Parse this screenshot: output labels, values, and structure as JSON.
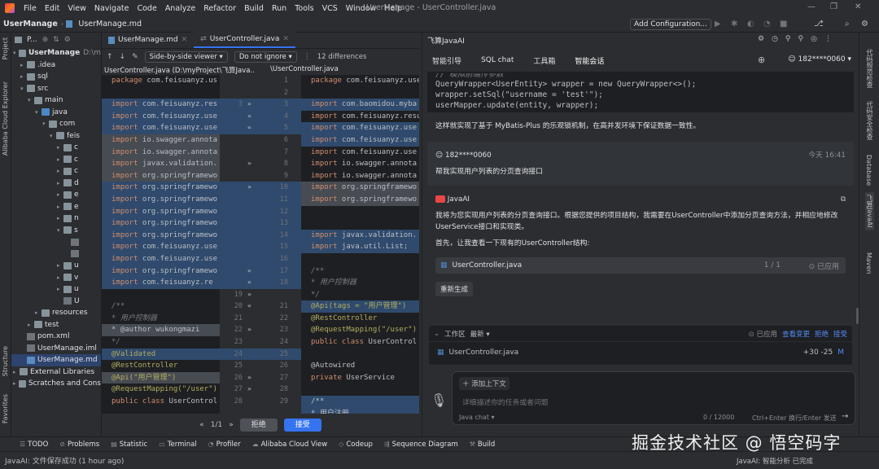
{
  "menu": [
    "File",
    "Edit",
    "View",
    "Navigate",
    "Code",
    "Analyze",
    "Refactor",
    "Build",
    "Run",
    "Tools",
    "VCS",
    "Window",
    "Help"
  ],
  "window_title": "UserManage - UserController.java",
  "breadcrumb": {
    "project": "UserManage",
    "file": "UserManage.md"
  },
  "add_config": "Add Configuration...",
  "project_panel": {
    "title": "P...",
    "tree": [
      {
        "label": "UserManage",
        "extra": "D:\\m",
        "indent": 0,
        "open": true,
        "icon": "folder",
        "bold": true
      },
      {
        "label": ".idea",
        "indent": 1,
        "open": false,
        "icon": "folder"
      },
      {
        "label": "sql",
        "indent": 1,
        "open": false,
        "icon": "folder"
      },
      {
        "label": "src",
        "indent": 1,
        "open": true,
        "icon": "folder"
      },
      {
        "label": "main",
        "indent": 2,
        "open": true,
        "icon": "folder"
      },
      {
        "label": "java",
        "indent": 3,
        "open": true,
        "icon": "src"
      },
      {
        "label": "com",
        "indent": 4,
        "open": true,
        "icon": "folder"
      },
      {
        "label": "feis",
        "indent": 5,
        "open": true,
        "icon": "folder"
      },
      {
        "label": "c",
        "indent": 6,
        "open": false,
        "icon": "folder"
      },
      {
        "label": "c",
        "indent": 6,
        "open": false,
        "icon": "folder"
      },
      {
        "label": "c",
        "indent": 6,
        "open": false,
        "icon": "folder"
      },
      {
        "label": "d",
        "indent": 6,
        "open": false,
        "icon": "folder"
      },
      {
        "label": "e",
        "indent": 6,
        "open": false,
        "icon": "folder"
      },
      {
        "label": "e",
        "indent": 6,
        "open": false,
        "icon": "folder"
      },
      {
        "label": "n",
        "indent": 6,
        "open": false,
        "icon": "folder"
      },
      {
        "label": "s",
        "indent": 6,
        "open": true,
        "icon": "folder"
      },
      {
        "label": "",
        "indent": 7,
        "open": false,
        "icon": "file"
      },
      {
        "label": "",
        "indent": 7,
        "open": false,
        "icon": "file"
      },
      {
        "label": "u",
        "indent": 6,
        "open": false,
        "icon": "folder"
      },
      {
        "label": "v",
        "indent": 6,
        "open": false,
        "icon": "folder"
      },
      {
        "label": "u",
        "indent": 6,
        "open": false,
        "icon": "folder"
      },
      {
        "label": "U",
        "indent": 6,
        "open": false,
        "icon": "file"
      },
      {
        "label": "resources",
        "indent": 3,
        "open": false,
        "icon": "folder"
      },
      {
        "label": "test",
        "indent": 2,
        "open": false,
        "icon": "folder"
      },
      {
        "label": "pom.xml",
        "indent": 1,
        "open": false,
        "icon": "file"
      },
      {
        "label": "UserManage.iml",
        "indent": 1,
        "open": false,
        "icon": "file"
      },
      {
        "label": "UserManage.md",
        "indent": 1,
        "open": false,
        "icon": "md",
        "selected": true
      },
      {
        "label": "External Libraries",
        "indent": 0,
        "open": false,
        "icon": "folder"
      },
      {
        "label": "Scratches and Cons",
        "indent": 0,
        "open": false,
        "icon": "folder"
      }
    ]
  },
  "editor_tabs": [
    "UserManage.md",
    "UserController.java"
  ],
  "diff_toolbar": {
    "viewer": "Side-by-side viewer",
    "ignore": "Do not ignore",
    "differences": "12 differences"
  },
  "diff_heads": {
    "left": "UserController.java (D:\\myProject\\飞算Java...",
    "right": "\\UserController.java"
  },
  "diff_left": [
    {
      "t": "package com.feisuanyz.us",
      "s": ""
    },
    {
      "t": "",
      "s": ""
    },
    {
      "t": "import com.feisuanyz.res",
      "s": "ch"
    },
    {
      "t": "import com.feisuanyz.use",
      "s": "ch"
    },
    {
      "t": "import com.feisuanyz.use",
      "s": "ch"
    },
    {
      "t": "import io.swagger.annota",
      "s": "del"
    },
    {
      "t": "import io.swagger.annota",
      "s": "del"
    },
    {
      "t": "import javax.validation.",
      "s": "del"
    },
    {
      "t": "import org.springframewo",
      "s": "del"
    },
    {
      "t": "import org.springframewo",
      "s": "ch"
    },
    {
      "t": "import org.springframewo",
      "s": "ch"
    },
    {
      "t": "import org.springframewo",
      "s": "ch"
    },
    {
      "t": "import org.springframewo",
      "s": "ch"
    },
    {
      "t": "import org.springframewo",
      "s": "ch"
    },
    {
      "t": "import com.feisuanyz.use",
      "s": "ch"
    },
    {
      "t": "import com.feisuanyz.use",
      "s": "ch"
    },
    {
      "t": "import org.springframewo",
      "s": "ch"
    },
    {
      "t": "import com.feisuanyz.re",
      "s": "ch"
    },
    {
      "t": "",
      "s": ""
    },
    {
      "t": "/**",
      "s": "cm"
    },
    {
      "t": " * 用户控制器",
      "s": "cm"
    },
    {
      "t": " * @author wukongmazi",
      "s": "del"
    },
    {
      "t": " */",
      "s": "cm"
    },
    {
      "t": "@Validated",
      "s": "ch"
    },
    {
      "t": "@RestController",
      "s": ""
    },
    {
      "t": "@Api(\"用户管理\")",
      "s": "del"
    },
    {
      "t": "@RequestMapping(\"/user\")",
      "s": ""
    },
    {
      "t": "public class UserControl",
      "s": ""
    }
  ],
  "diff_gutter": [
    {
      "a": "",
      "b": "1",
      "arrow": ""
    },
    {
      "a": "",
      "b": "2",
      "arrow": ""
    },
    {
      "a": "3",
      "b": "3",
      "arrow": "»"
    },
    {
      "a": "",
      "b": "4",
      "arrow": "»"
    },
    {
      "a": "",
      "b": "5",
      "arrow": "«"
    },
    {
      "a": "",
      "b": "6",
      "arrow": ""
    },
    {
      "a": "",
      "b": "7",
      "arrow": ""
    },
    {
      "a": "",
      "b": "8",
      "arrow": "»"
    },
    {
      "a": "",
      "b": "9",
      "arrow": ""
    },
    {
      "a": "",
      "b": "10",
      "arrow": "»"
    },
    {
      "a": "",
      "b": "11",
      "arrow": ""
    },
    {
      "a": "",
      "b": "12",
      "arrow": ""
    },
    {
      "a": "",
      "b": "13",
      "arrow": ""
    },
    {
      "a": "",
      "b": "14",
      "arrow": ""
    },
    {
      "a": "",
      "b": "15",
      "arrow": ""
    },
    {
      "a": "",
      "b": "16",
      "arrow": ""
    },
    {
      "a": "",
      "b": "17",
      "arrow": "«"
    },
    {
      "a": "",
      "b": "18",
      "arrow": "«"
    },
    {
      "a": "19",
      "b": "",
      "arrow": "»"
    },
    {
      "a": "20",
      "b": "21",
      "arrow": "«"
    },
    {
      "a": "21",
      "b": "22",
      "arrow": ""
    },
    {
      "a": "22",
      "b": "23",
      "arrow": "»"
    },
    {
      "a": "23",
      "b": "24",
      "arrow": ""
    },
    {
      "a": "24",
      "b": "25",
      "arrow": ""
    },
    {
      "a": "25",
      "b": "26",
      "arrow": ""
    },
    {
      "a": "26",
      "b": "27",
      "arrow": "»"
    },
    {
      "a": "27",
      "b": "28",
      "arrow": "»"
    },
    {
      "a": "28",
      "b": "29",
      "arrow": ""
    }
  ],
  "diff_right": [
    {
      "t": "package com.feisuanyz.use",
      "s": ""
    },
    {
      "t": "",
      "s": ""
    },
    {
      "t": "import com.baomidou.myba",
      "s": "ch"
    },
    {
      "t": "import com.feisuanyz.resu",
      "s": ""
    },
    {
      "t": "import com.feisuanyz.use",
      "s": "ch"
    },
    {
      "t": "import com.feisuanyz.use",
      "s": "ch"
    },
    {
      "t": "import com.feisuanyz.use",
      "s": ""
    },
    {
      "t": "import io.swagger.annota",
      "s": ""
    },
    {
      "t": "import io.swagger.annota",
      "s": ""
    },
    {
      "t": "import org.springframewo",
      "s": "del"
    },
    {
      "t": "import org.springframewo",
      "s": "del"
    },
    {
      "t": "",
      "s": ""
    },
    {
      "t": "",
      "s": ""
    },
    {
      "t": "import javax.validation.",
      "s": "ch"
    },
    {
      "t": "import java.util.List;",
      "s": "ch"
    },
    {
      "t": "",
      "s": ""
    },
    {
      "t": "/**",
      "s": "cm"
    },
    {
      "t": " * 用户控制器",
      "s": "cm"
    },
    {
      "t": " */",
      "s": "cm"
    },
    {
      "t": "@Api(tags = \"用户管理\")",
      "s": "ch"
    },
    {
      "t": "@RestController",
      "s": ""
    },
    {
      "t": "@RequestMapping(\"/user\")",
      "s": ""
    },
    {
      "t": "public class UserControl",
      "s": ""
    },
    {
      "t": "",
      "s": ""
    },
    {
      "t": "    @Autowired",
      "s": ""
    },
    {
      "t": "    private UserService",
      "s": ""
    },
    {
      "t": "",
      "s": ""
    },
    {
      "t": "    /**",
      "s": "ch"
    },
    {
      "t": "     * 用户注册",
      "s": "ch"
    }
  ],
  "diff_nav": {
    "pos": "1/1",
    "reject": "拒绝",
    "accept": "接受"
  },
  "ai": {
    "title": "飞算JavaAI",
    "tabs": [
      "智能引导",
      "SQL chat",
      "工具箱",
      "智能会话"
    ],
    "user": "182****0060",
    "code_lines": [
      "// 模拟前端传参数",
      "QueryWrapper<UserEntity> wrapper = new QueryWrapper<>();",
      "wrapper.setSql(\"username = 'test'\");",
      "userMapper.update(entity, wrapper);"
    ],
    "summary": "这样就实现了基于 MyBatis-Plus 的乐观锁机制，在高并发环境下保证数据一致性。",
    "user_msg": {
      "name": "182****0060",
      "time": "今天 16:41",
      "text": "帮我实现用户列表的分页查询接口"
    },
    "reply": {
      "name": "JavaAI",
      "p1": "我将为您实现用户列表的分页查询接口。根据您提供的项目结构，我需要在UserController中添加分页查询方法，并相应地修改UserService接口和实现类。",
      "p2": "首先，让我查看一下现有的UserController结构:",
      "file": "UserController.java",
      "count": "1 / 1",
      "applied": "已应用",
      "regen": "重新生成"
    },
    "workarea": {
      "label": "工作区",
      "sort": "最新",
      "applied": "已应用",
      "view": "查看变更",
      "reject": "拒绝",
      "accept": "接受",
      "file": "UserController.java",
      "stat": "+30 -25",
      "mark": "M"
    },
    "input": {
      "add_ctx": "添加上下文",
      "placeholder": "详细描述你的任务或者问题",
      "mode": "Java chat",
      "counter": "0 / 12000",
      "hint": "Ctrl+Enter 换行/Enter 发送"
    }
  },
  "right_stripe": [
    "代码规范检查",
    "代码安全检查",
    "Database",
    "飞算JavaAI",
    "Maven"
  ],
  "left_stripe": [
    "Project",
    "Alibaba Cloud Explorer",
    "Structure",
    "Favorites"
  ],
  "bottom_tools": [
    "TODO",
    "Problems",
    "Statistic",
    "Terminal",
    "Profiler",
    "Alibaba Cloud View",
    "Codeup",
    "Sequence Diagram",
    "Build"
  ],
  "status": {
    "left": "JavaAI: 文件保存成功 (1 hour ago)",
    "right": "JavaAI: 智能分析  已完成"
  },
  "watermark": "掘金技术社区 @ 悟空码字"
}
